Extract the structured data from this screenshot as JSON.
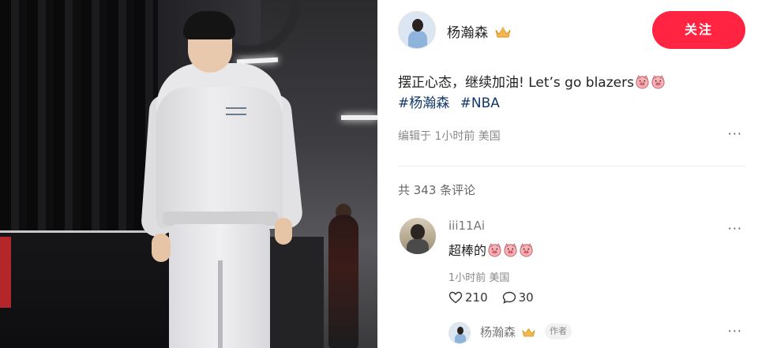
{
  "photo": {
    "icon": "person-photo"
  },
  "author": {
    "name": "杨瀚森",
    "badge_icon": "crown-icon",
    "follow_label": "关注"
  },
  "post": {
    "text": "摆正心态，继续加油! Let’s go blazers",
    "emojis": [
      "pig-face-icon",
      "pig-face-icon"
    ],
    "hashtags": [
      "#杨瀚森",
      "#NBA"
    ],
    "meta": "编辑于 1小时前 美国",
    "more": "···"
  },
  "comments": {
    "count_label": "共 343 条评论",
    "items": [
      {
        "user": "iii11Ai",
        "text": "超棒的",
        "emojis": [
          "pig-face-icon",
          "pig-face-icon",
          "pig-face-icon"
        ],
        "meta": "1小时前 美国",
        "likes": "210",
        "replies": "30",
        "more": "···"
      }
    ],
    "reply": {
      "user": "杨瀚森",
      "badge": "作者",
      "more": "···"
    }
  },
  "colors": {
    "accent": "#ff2442",
    "hashtag": "#13386c",
    "muted": "#8a8a8a"
  }
}
